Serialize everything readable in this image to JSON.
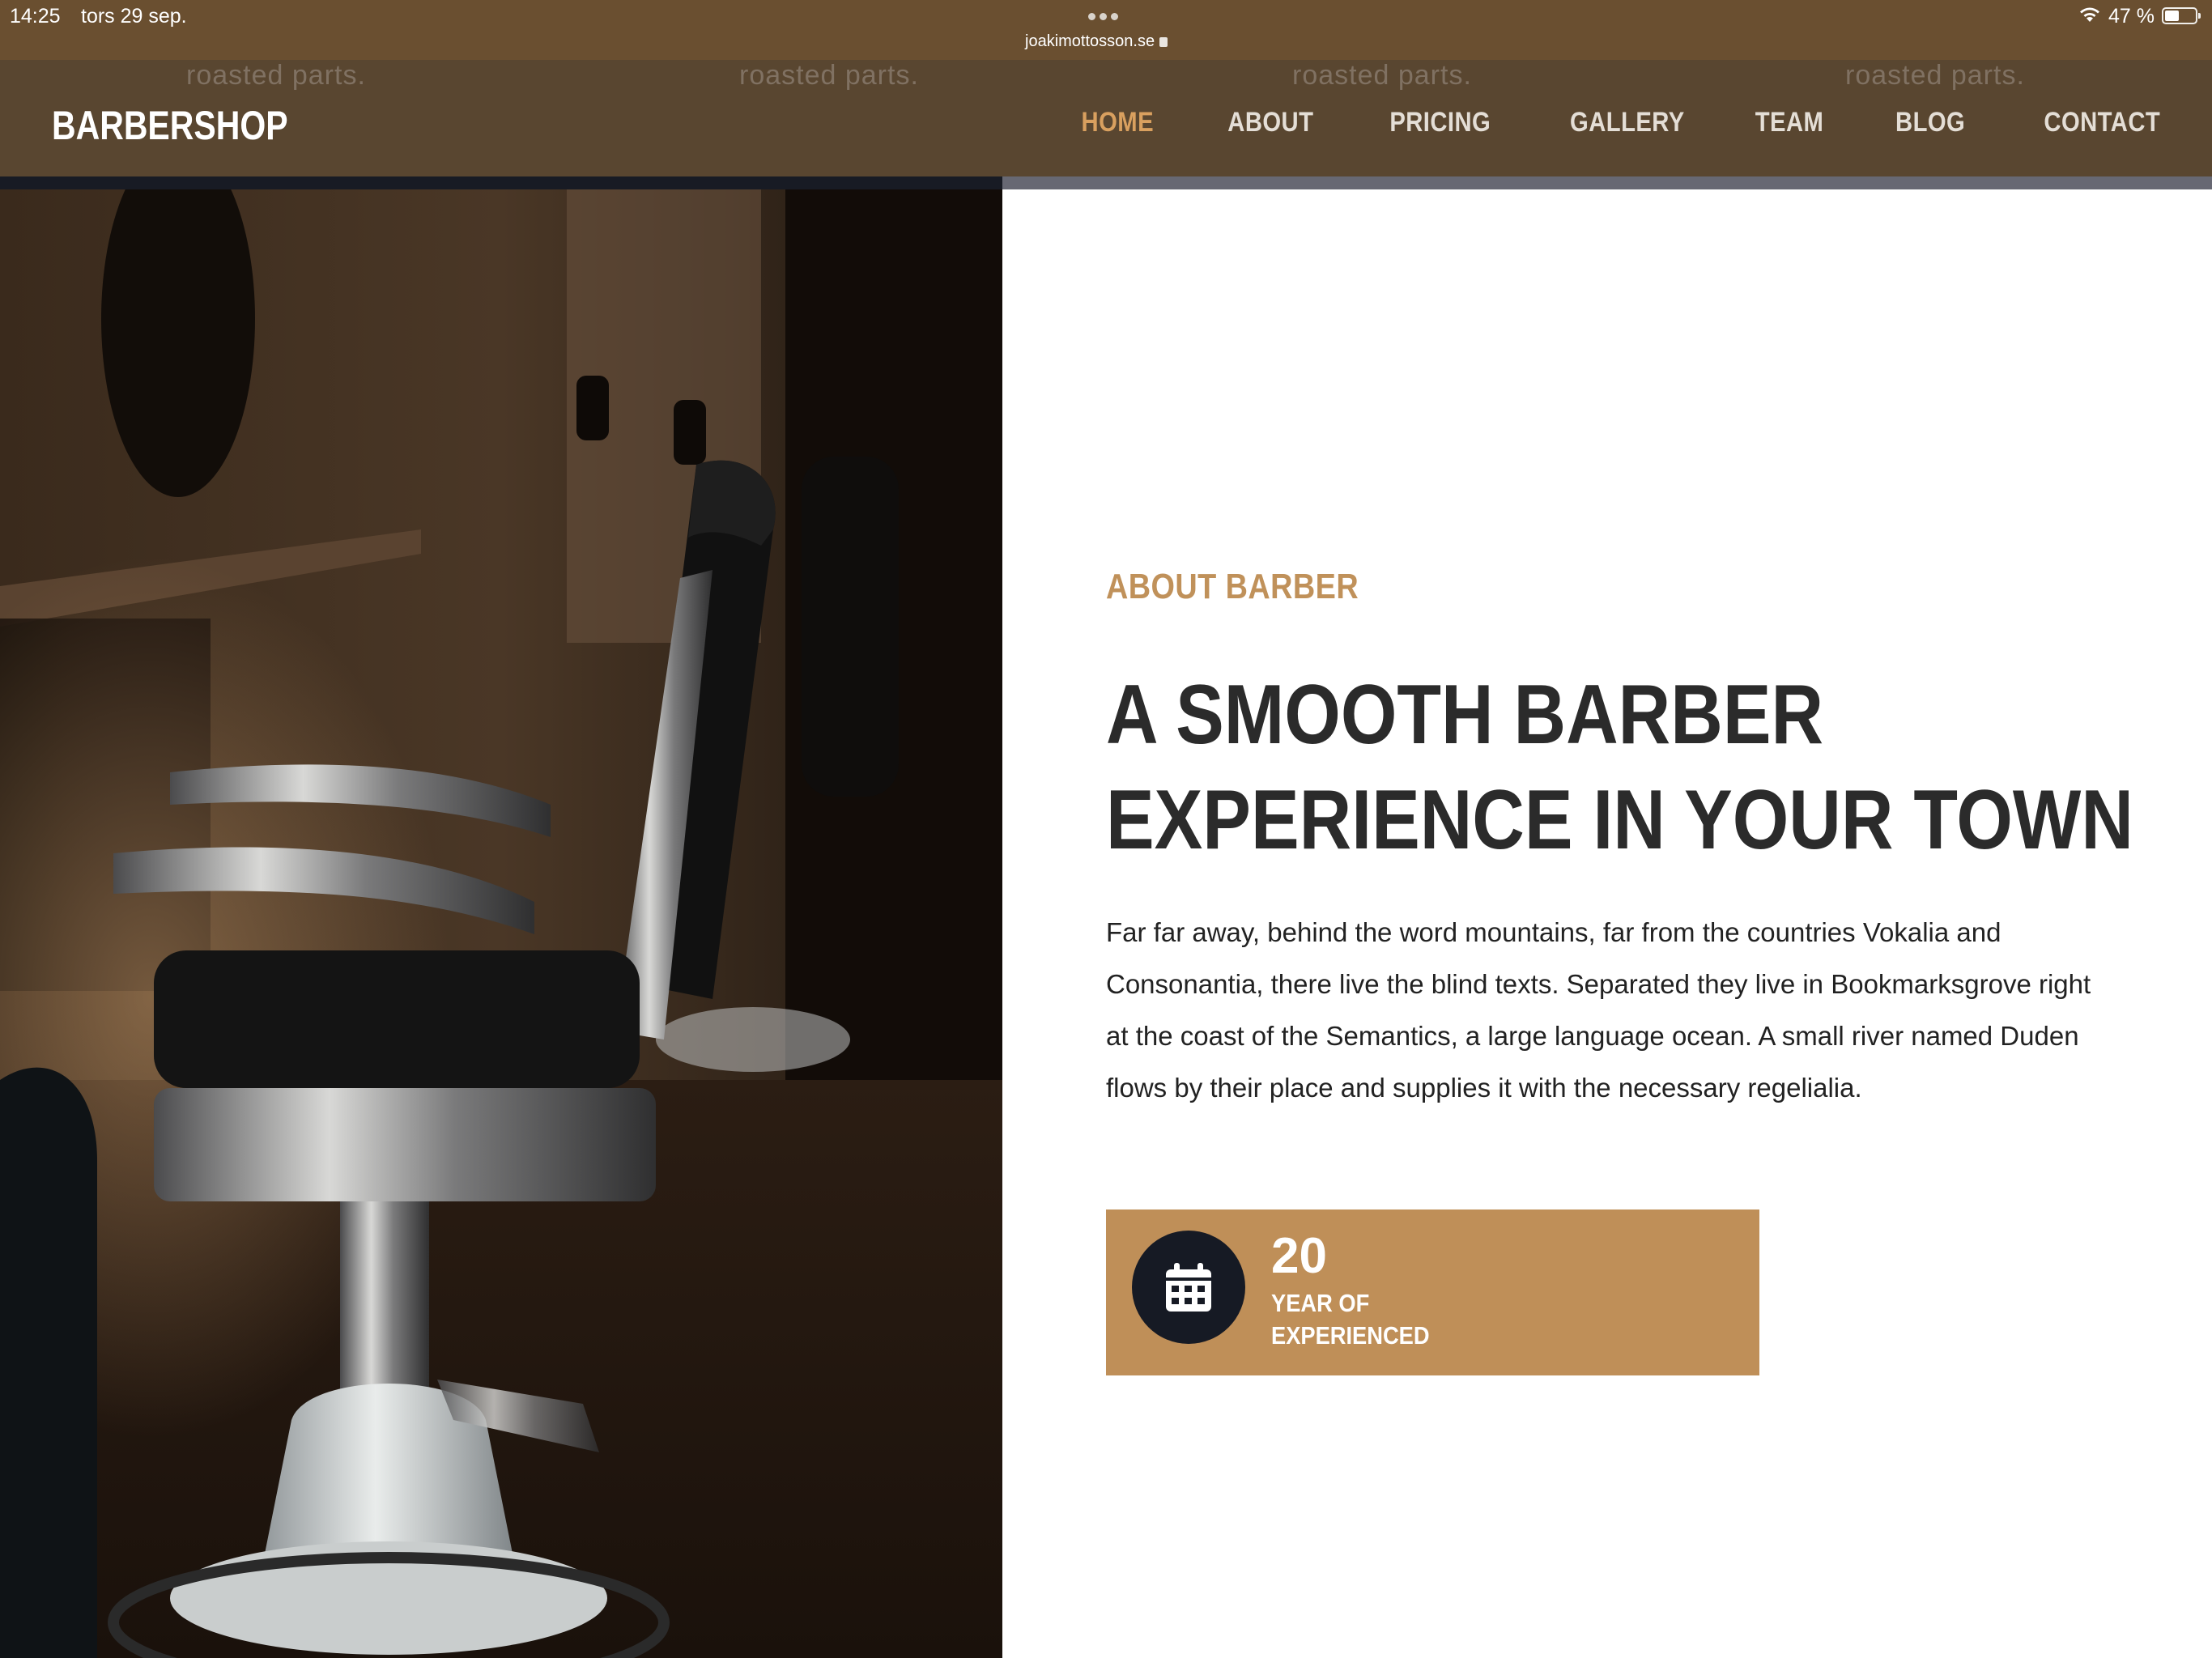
{
  "status_bar": {
    "time": "14:25",
    "date": "tors 29 sep.",
    "url": "joakimottosson.se",
    "battery_percent": "47 %",
    "battery_level": 0.47
  },
  "navbar": {
    "ghost_text": [
      "roasted parts.",
      "roasted parts.",
      "roasted parts.",
      "roasted parts."
    ],
    "brand": "BARBERSHOP",
    "items": [
      {
        "label": "HOME",
        "active": true
      },
      {
        "label": "ABOUT",
        "active": false
      },
      {
        "label": "PRICING",
        "active": false
      },
      {
        "label": "GALLERY",
        "active": false
      },
      {
        "label": "TEAM",
        "active": false
      },
      {
        "label": "BLOG",
        "active": false
      },
      {
        "label": "CONTACT",
        "active": false
      }
    ]
  },
  "about": {
    "eyebrow": "ABOUT BARBER",
    "title": "A SMOOTH BARBER EXPERIENCE IN YOUR TOWN",
    "body": "Far far away, behind the word mountains, far from the countries Vokalia and Consonantia, there live the blind texts. Separated they live in Bookmarksgrove right at the coast of the Semantics, a large language ocean. A small river named Duden flows by their place and supplies it with the necessary regelialia."
  },
  "experience": {
    "icon": "calendar-icon",
    "number": "20",
    "label": "YEAR OF\nEXPERIENCED"
  },
  "colors": {
    "status_bar_bg": "#6a4f30",
    "navbar_bg": "#594630",
    "accent": "#c0915a",
    "nav_active": "#d9a05f",
    "title_text": "#2b2b2b",
    "icon_circle": "#161a24"
  }
}
